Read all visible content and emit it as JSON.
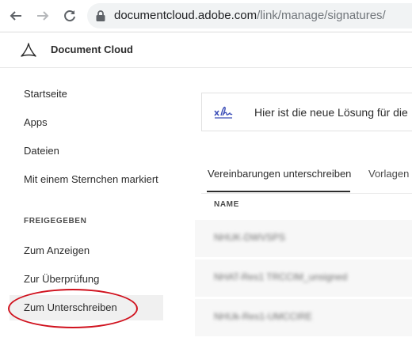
{
  "browser": {
    "url_host": "documentcloud.adobe.com",
    "url_path": "/link/manage/signatures/"
  },
  "app": {
    "title": "Document Cloud"
  },
  "sidebar": {
    "items": [
      {
        "label": "Startseite"
      },
      {
        "label": "Apps"
      },
      {
        "label": "Dateien"
      },
      {
        "label": "Mit einem Sternchen markiert"
      }
    ],
    "section_label": "FREIGEGEBEN",
    "shared_items": [
      {
        "label": "Zum Anzeigen"
      },
      {
        "label": "Zur Überprüfung"
      },
      {
        "label": "Zum Unterschreiben",
        "active": true
      }
    ]
  },
  "main": {
    "banner_text": "Hier ist die neue Lösung für die",
    "tabs": [
      {
        "label": "Vereinbarungen unterschreiben",
        "selected": true
      },
      {
        "label": "Vorlagen"
      }
    ],
    "column_header": "NAME",
    "rows": [
      {
        "name": "NHUK-DWVSPS"
      },
      {
        "name": "NHAT-Res1 TRCCIM_unsigned"
      },
      {
        "name": "NHUk-Res1-UMCCIRE"
      }
    ]
  },
  "colors": {
    "highlight_oval": "#d0121e",
    "sign_icon": "#3d4fb8"
  }
}
